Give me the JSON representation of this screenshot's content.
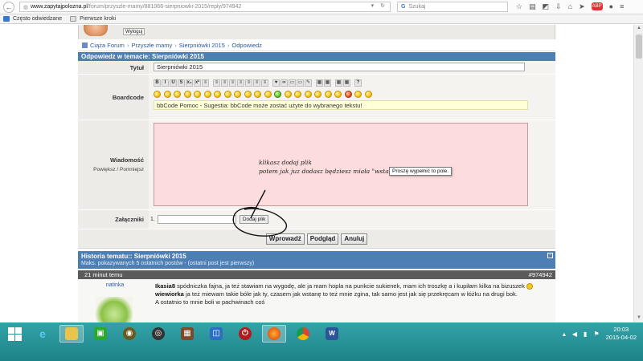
{
  "browser": {
    "url_host": "www.zapytajpolozna.pl",
    "url_path": "/forum/przyszle-mamy/881066-sierpniowki-2015/reply/974942",
    "search_placeholder": "Szukaj",
    "search_engine_glyph": "G",
    "bookmarks": [
      {
        "label": "Często odwiedzane"
      },
      {
        "label": "Pierwsze kroki"
      }
    ]
  },
  "profile": {
    "logout_label": "Wyloguj"
  },
  "breadcrumb": {
    "items": [
      "Ciąża Forum",
      "Przyszłe mamy",
      "Sierpniówki 2015",
      "Odpowiedz"
    ]
  },
  "reply": {
    "header": "Odpowiedz w temacie: Sierpniówki 2015",
    "title_label": "Tytuł",
    "title_value": "Sierpniówki 2015",
    "bbcode_label": "Boardcode",
    "bbcode_help": "bbCode Pomoc - Sugestia: bbCode może zostać użyte do wybranego tekstu!",
    "toolbar": [
      "B",
      "I",
      "U",
      "S",
      "x₂",
      "x²",
      "≡",
      "≡",
      "≡",
      "≡",
      "≡",
      "≡",
      "≡",
      "≡",
      "♥",
      "∞",
      "▭",
      "▭",
      "✎",
      "▦",
      "▦",
      "▦",
      "▦",
      "?"
    ],
    "message_label": "Wiadomość",
    "enlarge_label": "Powiększ",
    "shrink_label": "Pomniejsz",
    "message_line1": "klikasz dodaj plik",
    "message_line2": "potem jak juz dodasz będziesz miała \"wstaw\"",
    "validation_tip": "Proszę wypełnić to pole.",
    "attachments_label": "Załączniki",
    "attachment_number": "1.",
    "attach_button": "Dodaj plik",
    "submit_label": "Wprowadź",
    "preview_label": "Podgląd",
    "cancel_label": "Anuluj"
  },
  "history": {
    "title": "Historia tematu:: Sierpniówki 2015",
    "subtitle": "Maks. pokazywanych 5 ostatnich postów - (ostatni post jest pierwszy)",
    "collapse_glyph": "−"
  },
  "post": {
    "time": "21 minut temu",
    "id": "#974942",
    "author": "natinka",
    "user1": "Ikasia8",
    "text1": " spódniczka fajna, ja też stawiam na wygodę, ale ja mam hopla na punkcie sukienek, mam ich troszkę a i kupiłam kilka na bizuszek",
    "user2": "wiewiorka",
    "text2": " ja też miewam takie bóle jak ty, czasem jak wstanę to też mnie zgina, tak samo jest jak się przekręcam w łóżku na drugi bok.",
    "text3": "A ostatnio to mnie boli w pachwinach coś"
  },
  "taskbar": {
    "time": "20:03",
    "date": "2015-04-02"
  },
  "colors": {
    "forum_header": "#4e7fb4",
    "message_bg": "#fcdcdc",
    "taskbar": "#1d8388"
  }
}
